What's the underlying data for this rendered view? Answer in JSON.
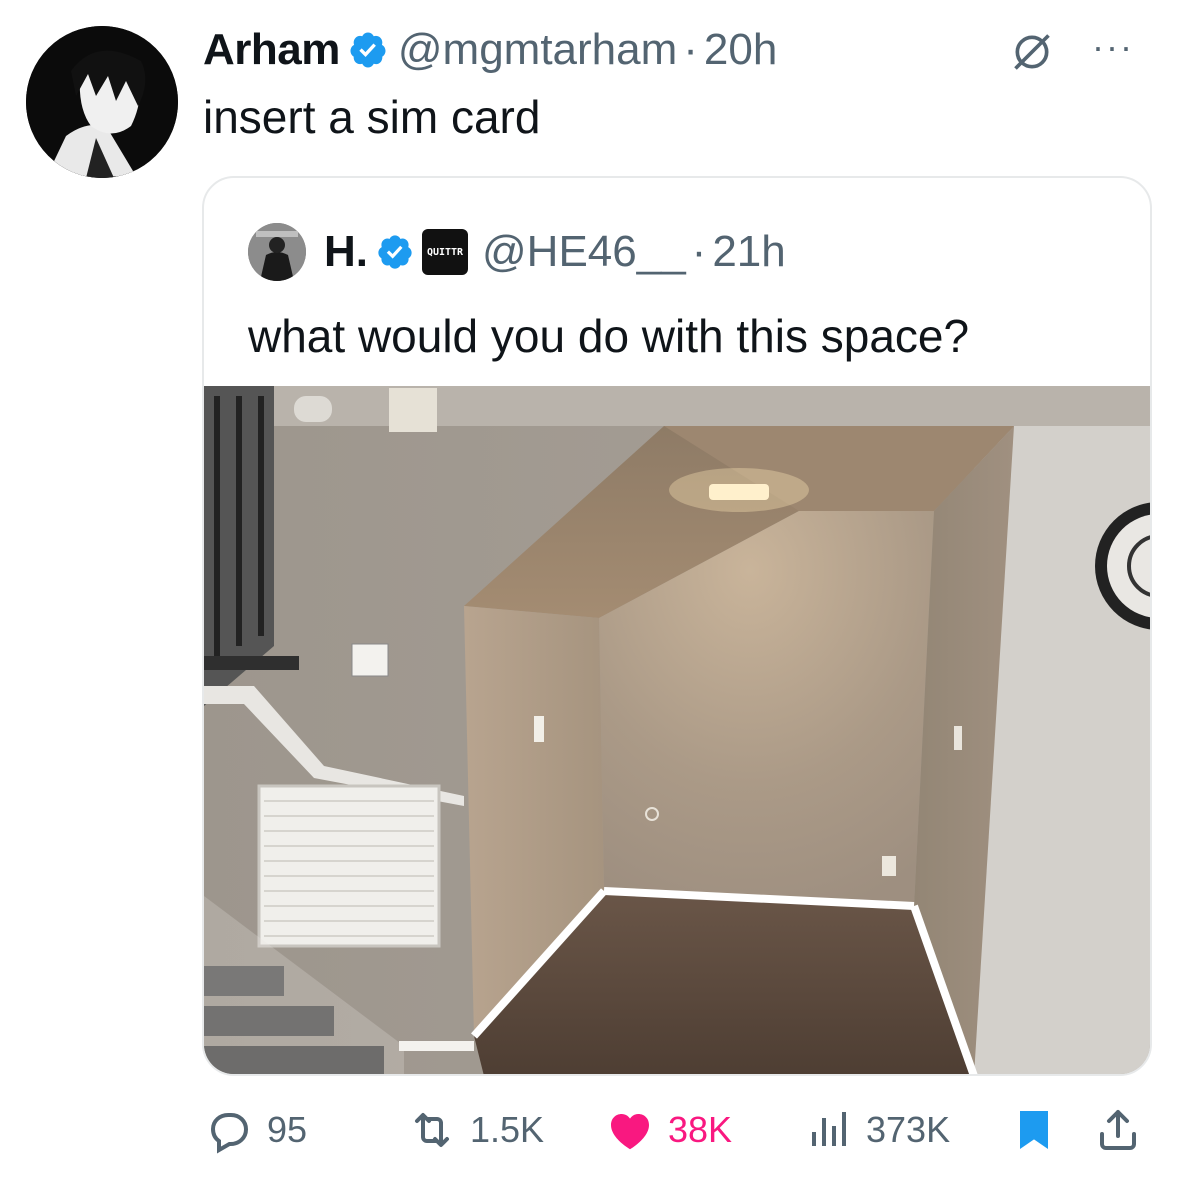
{
  "tweet": {
    "author_name": "Arham",
    "handle": "@mgmtarham",
    "separator": "·",
    "time": "20h",
    "text": "insert a sim card",
    "more_label": "···"
  },
  "quoted_tweet": {
    "author_name": "H.",
    "badge_text": "QUITTR",
    "handle": "@HE46__",
    "separator": "·",
    "time": "21h",
    "text": "what would you do with this space?"
  },
  "actions": {
    "replies": "95",
    "reposts": "1.5K",
    "likes": "38K",
    "views": "373K"
  },
  "colors": {
    "verified_blue": "#1d9bf0",
    "like_pink": "#f91880",
    "muted_text": "#536471",
    "bookmark_blue": "#1d9bf0"
  },
  "icons": [
    "grok-icon",
    "more-icon",
    "verified-icon",
    "reply-icon",
    "repost-icon",
    "like-icon",
    "views-icon",
    "bookmark-icon",
    "share-icon"
  ]
}
